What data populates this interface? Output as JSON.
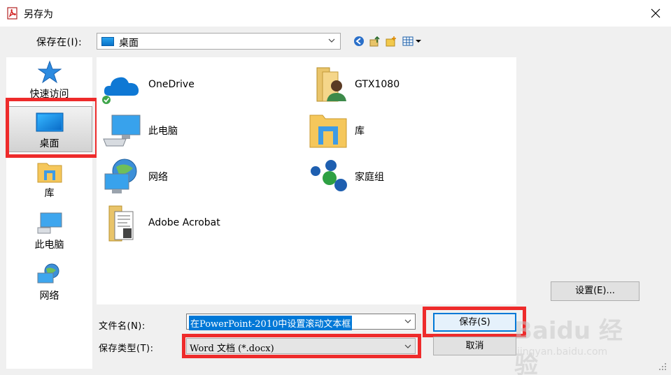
{
  "window": {
    "title": "另存为",
    "icon": "pdf-app-icon"
  },
  "toolbar": {
    "lookin_label": "保存在(I):",
    "lookin_value": "桌面",
    "buttons": [
      "back-icon",
      "up-folder-icon",
      "new-folder-icon",
      "view-menu-icon"
    ]
  },
  "places": [
    {
      "label": "快速访问",
      "icon": "star-icon"
    },
    {
      "label": "桌面",
      "icon": "desktop-icon",
      "selected": true
    },
    {
      "label": "库",
      "icon": "library-icon"
    },
    {
      "label": "此电脑",
      "icon": "computer-icon"
    },
    {
      "label": "网络",
      "icon": "network-icon"
    }
  ],
  "files": [
    {
      "label": "OneDrive",
      "icon": "onedrive-icon"
    },
    {
      "label": "GTX1080",
      "icon": "user-folder-icon"
    },
    {
      "label": "此电脑",
      "icon": "computer-icon"
    },
    {
      "label": "库",
      "icon": "library-icon"
    },
    {
      "label": "网络",
      "icon": "network-icon"
    },
    {
      "label": "家庭组",
      "icon": "homegroup-icon"
    },
    {
      "label": "Adobe Acrobat",
      "icon": "folder-icon"
    }
  ],
  "settings_label": "设置(E)...",
  "filename": {
    "label": "文件名(N):",
    "value": "在PowerPoint-2010中设置滚动文本框"
  },
  "filetype": {
    "label": "保存类型(T):",
    "value": "Word 文档 (*.docx)"
  },
  "save_label": "保存(S)",
  "cancel_label": "取消",
  "watermark": {
    "brand": "Baidu 经验",
    "url": "jingyan.baidu.com"
  },
  "colors": {
    "accent": "#0078d7",
    "highlight_box": "#ee2b2b",
    "dialog_bg": "#f0f0f0"
  }
}
